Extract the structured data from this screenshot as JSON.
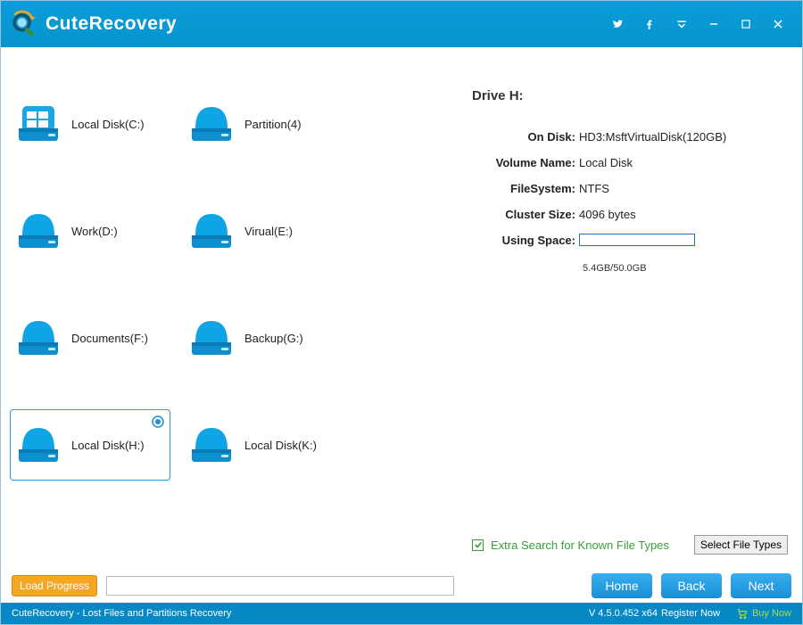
{
  "app": {
    "name": "CuteRecovery"
  },
  "window_controls": [
    "twitter",
    "facebook",
    "dropdown",
    "minimize",
    "maximize",
    "close"
  ],
  "drives": [
    {
      "label": "Local Disk(C:)",
      "icon": "windows-disk",
      "selected": false
    },
    {
      "label": "Partition(4)",
      "icon": "disk",
      "selected": false
    },
    {
      "label": "Work(D:)",
      "icon": "disk",
      "selected": false
    },
    {
      "label": "Virual(E:)",
      "icon": "disk",
      "selected": false
    },
    {
      "label": "Documents(F:)",
      "icon": "disk",
      "selected": false
    },
    {
      "label": "Backup(G:)",
      "icon": "disk",
      "selected": false
    },
    {
      "label": "Local Disk(H:)",
      "icon": "disk",
      "selected": true
    },
    {
      "label": "Local Disk(K:)",
      "icon": "disk",
      "selected": false
    }
  ],
  "info": {
    "title": "Drive H:",
    "on_disk_label": "On Disk:",
    "on_disk_val": "HD3:MsftVirtualDisk(120GB)",
    "volume_name_label": "Volume Name:",
    "volume_name_val": "Local Disk",
    "filesystem_label": "FileSystem:",
    "filesystem_val": "NTFS",
    "cluster_label": "Cluster Size:",
    "cluster_val": "4096 bytes",
    "using_label": "Using Space:",
    "using_text": "5.4GB/50.0GB",
    "using_percent": 11,
    "extra_label": "Extra Search for Known File Types",
    "extra_checked": true,
    "select_types_btn": "Select File Types"
  },
  "footer": {
    "load_progress": "Load Progress",
    "home": "Home",
    "back": "Back",
    "next": "Next"
  },
  "status": {
    "tagline": "CuteRecovery - Lost Files and Partitions Recovery",
    "version": "V 4.5.0.452 x64",
    "register": "Register Now",
    "buy": "Buy Now"
  }
}
